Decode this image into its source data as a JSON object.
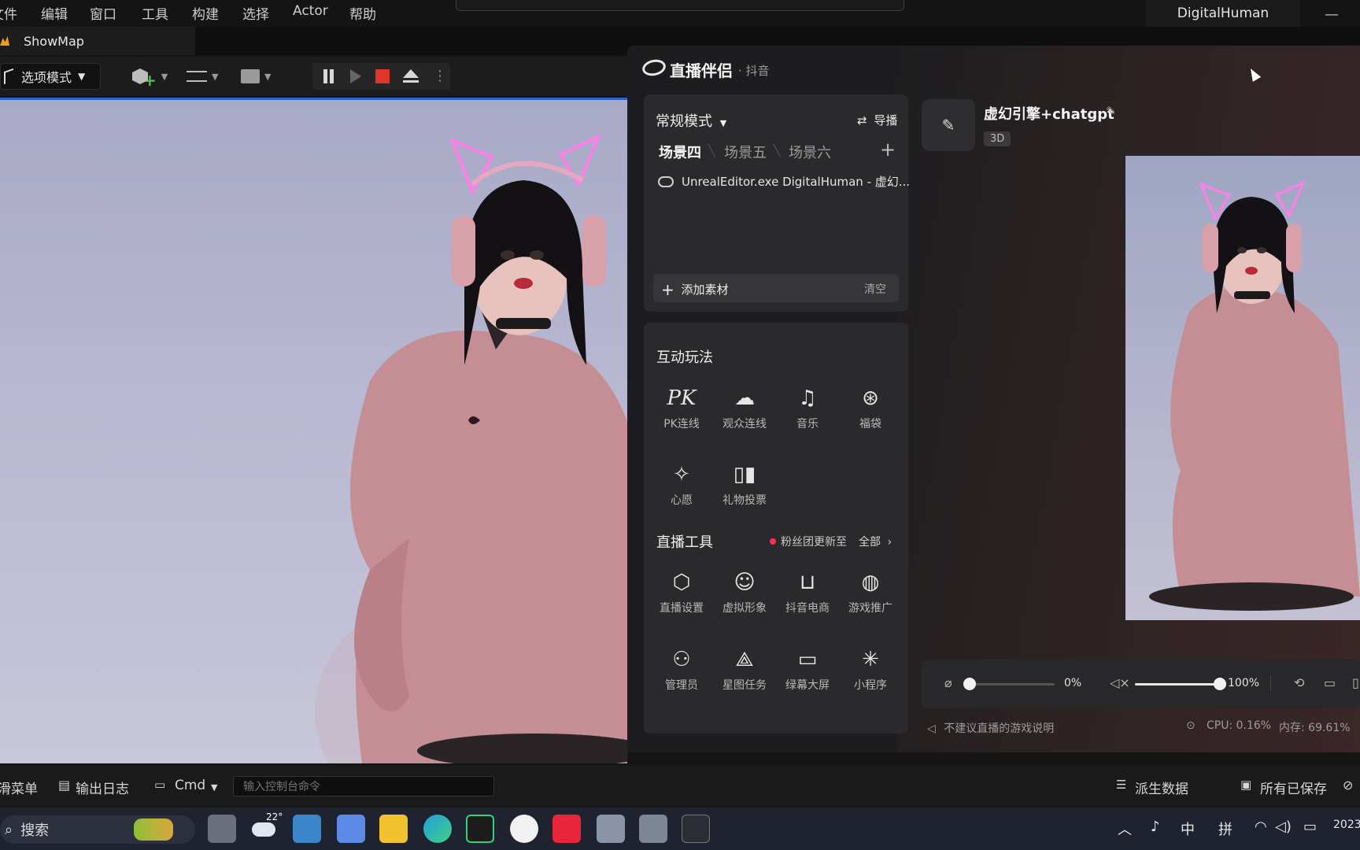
{
  "menu": [
    "文件",
    "编辑",
    "窗口",
    "工具",
    "构建",
    "选择",
    "Actor",
    "帮助"
  ],
  "app_title": "DigitalHuman",
  "map_tab": "ShowMap",
  "toolbar": {
    "mode_label": "选项模式"
  },
  "bottom_bar": {
    "content_browser": "内容侧滑菜单",
    "output_log": "输出日志",
    "cmd_label": "Cmd",
    "console_placeholder": "输入控制台命令",
    "derived_data": "派生数据",
    "all_saved": "所有已保存"
  },
  "taskbar": {
    "search": "搜索",
    "weather": "22°",
    "ime_lang": "中",
    "ime_mode": "拼",
    "clock_year": "2023"
  },
  "panel": {
    "title": "直播伴侣",
    "subtitle": "· 抖音",
    "mode": "常规模式",
    "guide": "导播",
    "scenes": [
      "场景四",
      "场景五",
      "场景六"
    ],
    "source": "UnrealEditor.exe DigitalHuman - 虚幻...",
    "add_source": "添加素材",
    "clear": "清空",
    "interactive_title": "互动玩法",
    "interactive_items": [
      "PK连线",
      "观众连线",
      "音乐",
      "福袋",
      "心愿",
      "礼物投票"
    ],
    "tools_title": "直播工具",
    "tools_notice": "粉丝团更新至",
    "tools_all": "全部",
    "tool_items": [
      "直播设置",
      "虚拟形象",
      "抖音电商",
      "游戏推广",
      "管理员",
      "星图任务",
      "绿幕大屏",
      "小程序"
    ],
    "room_title": "虚幻引擎+chatgpt",
    "room_tag": "3D",
    "mic_percent": "0%",
    "speaker_percent": "100%",
    "mic_level": 0,
    "speaker_level": 1,
    "footer_notice": "不建议直播的游戏说明",
    "cpu": "CPU: 0.16%",
    "mem": "内存: 69.61%"
  }
}
